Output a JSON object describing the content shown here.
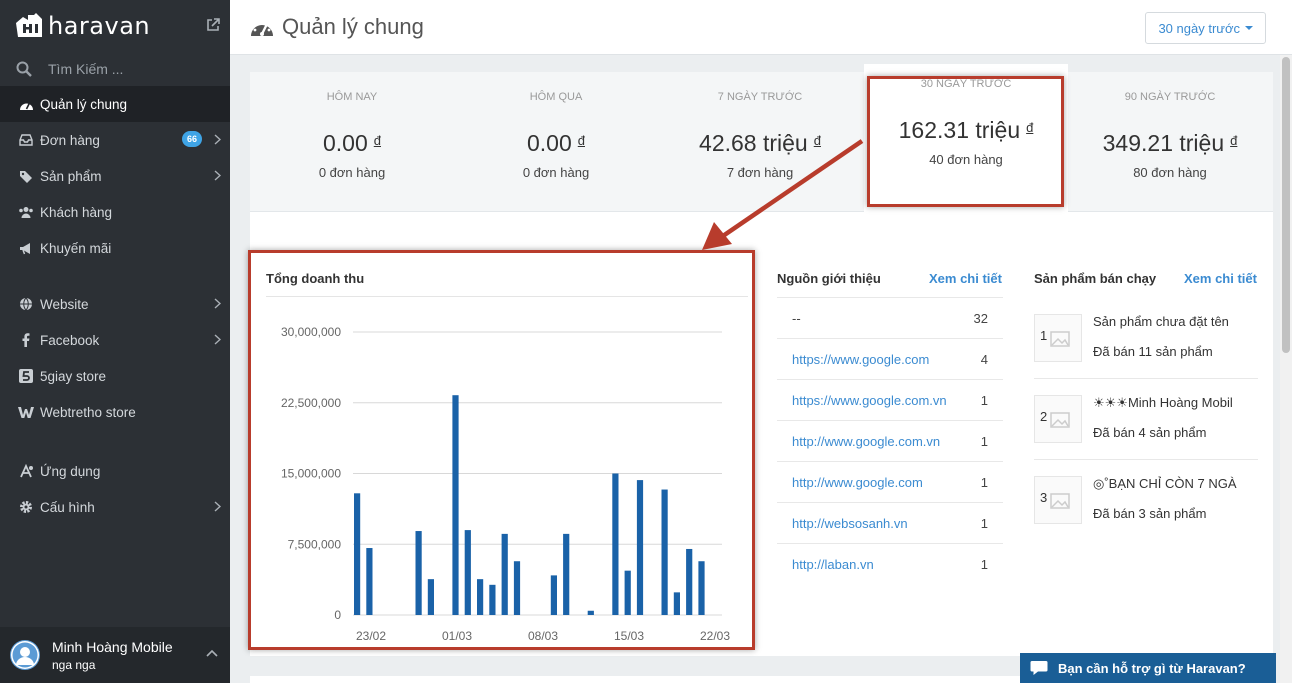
{
  "app": {
    "name": "haravan"
  },
  "sidebar": {
    "search_placeholder": "Tìm Kiếm ...",
    "items": [
      {
        "label": "Quản lý chung",
        "icon": "dashboard-icon",
        "active": true
      },
      {
        "label": "Đơn hàng",
        "icon": "inbox-icon",
        "badge": "66"
      },
      {
        "label": "Sản phẩm",
        "icon": "tags-icon"
      },
      {
        "label": "Khách hàng",
        "icon": "users-icon"
      },
      {
        "label": "Khuyến mãi",
        "icon": "bullhorn-icon"
      },
      {
        "label": "Website",
        "icon": "globe-icon"
      },
      {
        "label": "Facebook",
        "icon": "facebook-icon"
      },
      {
        "label": "5giay store",
        "icon": "5giay-icon"
      },
      {
        "label": "Webtretho store",
        "icon": "webtretho-icon"
      },
      {
        "label": "Ứng dụng",
        "icon": "apps-icon"
      },
      {
        "label": "Cấu hình",
        "icon": "gear-icon"
      }
    ],
    "user": {
      "name": "Minh Hoàng Mobile",
      "sub": "nga nga"
    }
  },
  "header": {
    "title": "Quản lý chung",
    "range_label": "30 ngày trước"
  },
  "stats": [
    {
      "label": "HÔM NAY",
      "value": "0.00",
      "currency": "đ",
      "orders": "0 đơn hàng"
    },
    {
      "label": "HÔM QUA",
      "value": "0.00",
      "currency": "đ",
      "orders": "0 đơn hàng"
    },
    {
      "label": "7 NGÀY TRƯỚC",
      "value": "42.68 triệu",
      "currency": "đ",
      "orders": "7 đơn hàng"
    },
    {
      "label": "30 NGÀY TRƯỚC",
      "value": "162.31 triệu",
      "currency": "đ",
      "orders": "40 đơn hàng"
    },
    {
      "label": "90 NGÀY TRƯỚC",
      "value": "349.21 triệu",
      "currency": "đ",
      "orders": "80 đơn hàng"
    }
  ],
  "chart": {
    "title": "Tổng doanh thu"
  },
  "chart_data": {
    "type": "bar",
    "title": "Tổng doanh thu",
    "ylim": [
      0,
      30000000
    ],
    "yticks": [
      "30,000,000",
      "22,500,000",
      "15,000,000",
      "7,500,000",
      "0"
    ],
    "ytick_values": [
      30000000,
      22500000,
      15000000,
      7500000,
      0
    ],
    "xticks": [
      "23/02",
      "01/03",
      "08/03",
      "15/03",
      "22/03"
    ],
    "bar_color": "#1a62a8",
    "values": [
      12900000,
      7100000,
      0,
      0,
      0,
      8900000,
      3800000,
      0,
      23300000,
      9000000,
      3800000,
      3200000,
      8600000,
      5700000,
      0,
      0,
      4200000,
      8600000,
      0,
      450000,
      0,
      15000000,
      4700000,
      14300000,
      0,
      13300000,
      2400000,
      7000000,
      5700000
    ]
  },
  "referrals": {
    "title": "Nguồn giới thiệu",
    "link": "Xem chi tiết",
    "rows": [
      {
        "source": "--",
        "count": "32"
      },
      {
        "source": "https://www.google.com",
        "count": "4"
      },
      {
        "source": "https://www.google.com.vn",
        "count": "1"
      },
      {
        "source": "http://www.google.com.vn",
        "count": "1"
      },
      {
        "source": "http://www.google.com",
        "count": "1"
      },
      {
        "source": "http://websosanh.vn",
        "count": "1"
      },
      {
        "source": "http://laban.vn",
        "count": "1"
      }
    ]
  },
  "bestsellers": {
    "title": "Sản phẩm bán chạy",
    "link": "Xem chi tiết",
    "items": [
      {
        "rank": "1",
        "name": "Sản phẩm chưa đặt tên",
        "sold": "Đã bán 11 sản phẩm"
      },
      {
        "rank": "2",
        "name": "☀☀☀Minh Hoàng Mobil",
        "sold": "Đã bán 4 sản phẩm"
      },
      {
        "rank": "3",
        "name": "◎˚BẠN CHỈ CÒN 7 NGÀ",
        "sold": "Đã bán 3 sản phẩm"
      }
    ]
  },
  "support": {
    "label": "Bạn cần hỗ trợ gì từ Haravan?"
  },
  "colors": {
    "sidebar": "#2c3035",
    "accent": "#3b8bd1",
    "highlight": "#b83c2c",
    "bar": "#1a62a8"
  }
}
